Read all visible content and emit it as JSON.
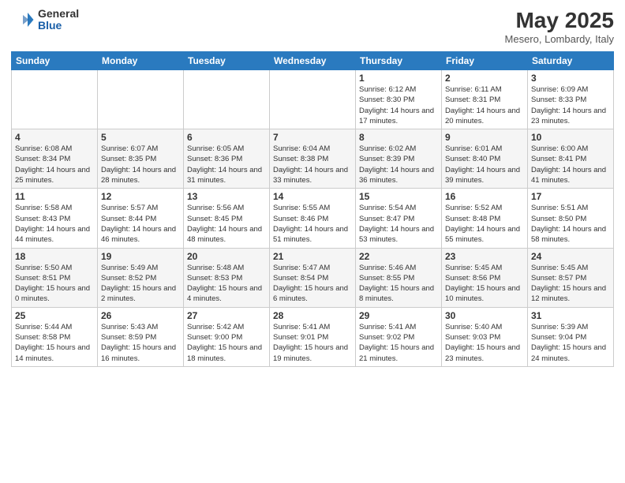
{
  "header": {
    "logo_general": "General",
    "logo_blue": "Blue",
    "title": "May 2025",
    "subtitle": "Mesero, Lombardy, Italy"
  },
  "days_of_week": [
    "Sunday",
    "Monday",
    "Tuesday",
    "Wednesday",
    "Thursday",
    "Friday",
    "Saturday"
  ],
  "weeks": [
    [
      {
        "day": "",
        "info": ""
      },
      {
        "day": "",
        "info": ""
      },
      {
        "day": "",
        "info": ""
      },
      {
        "day": "",
        "info": ""
      },
      {
        "day": "1",
        "info": "Sunrise: 6:12 AM\nSunset: 8:30 PM\nDaylight: 14 hours\nand 17 minutes."
      },
      {
        "day": "2",
        "info": "Sunrise: 6:11 AM\nSunset: 8:31 PM\nDaylight: 14 hours\nand 20 minutes."
      },
      {
        "day": "3",
        "info": "Sunrise: 6:09 AM\nSunset: 8:33 PM\nDaylight: 14 hours\nand 23 minutes."
      }
    ],
    [
      {
        "day": "4",
        "info": "Sunrise: 6:08 AM\nSunset: 8:34 PM\nDaylight: 14 hours\nand 25 minutes."
      },
      {
        "day": "5",
        "info": "Sunrise: 6:07 AM\nSunset: 8:35 PM\nDaylight: 14 hours\nand 28 minutes."
      },
      {
        "day": "6",
        "info": "Sunrise: 6:05 AM\nSunset: 8:36 PM\nDaylight: 14 hours\nand 31 minutes."
      },
      {
        "day": "7",
        "info": "Sunrise: 6:04 AM\nSunset: 8:38 PM\nDaylight: 14 hours\nand 33 minutes."
      },
      {
        "day": "8",
        "info": "Sunrise: 6:02 AM\nSunset: 8:39 PM\nDaylight: 14 hours\nand 36 minutes."
      },
      {
        "day": "9",
        "info": "Sunrise: 6:01 AM\nSunset: 8:40 PM\nDaylight: 14 hours\nand 39 minutes."
      },
      {
        "day": "10",
        "info": "Sunrise: 6:00 AM\nSunset: 8:41 PM\nDaylight: 14 hours\nand 41 minutes."
      }
    ],
    [
      {
        "day": "11",
        "info": "Sunrise: 5:58 AM\nSunset: 8:43 PM\nDaylight: 14 hours\nand 44 minutes."
      },
      {
        "day": "12",
        "info": "Sunrise: 5:57 AM\nSunset: 8:44 PM\nDaylight: 14 hours\nand 46 minutes."
      },
      {
        "day": "13",
        "info": "Sunrise: 5:56 AM\nSunset: 8:45 PM\nDaylight: 14 hours\nand 48 minutes."
      },
      {
        "day": "14",
        "info": "Sunrise: 5:55 AM\nSunset: 8:46 PM\nDaylight: 14 hours\nand 51 minutes."
      },
      {
        "day": "15",
        "info": "Sunrise: 5:54 AM\nSunset: 8:47 PM\nDaylight: 14 hours\nand 53 minutes."
      },
      {
        "day": "16",
        "info": "Sunrise: 5:52 AM\nSunset: 8:48 PM\nDaylight: 14 hours\nand 55 minutes."
      },
      {
        "day": "17",
        "info": "Sunrise: 5:51 AM\nSunset: 8:50 PM\nDaylight: 14 hours\nand 58 minutes."
      }
    ],
    [
      {
        "day": "18",
        "info": "Sunrise: 5:50 AM\nSunset: 8:51 PM\nDaylight: 15 hours\nand 0 minutes."
      },
      {
        "day": "19",
        "info": "Sunrise: 5:49 AM\nSunset: 8:52 PM\nDaylight: 15 hours\nand 2 minutes."
      },
      {
        "day": "20",
        "info": "Sunrise: 5:48 AM\nSunset: 8:53 PM\nDaylight: 15 hours\nand 4 minutes."
      },
      {
        "day": "21",
        "info": "Sunrise: 5:47 AM\nSunset: 8:54 PM\nDaylight: 15 hours\nand 6 minutes."
      },
      {
        "day": "22",
        "info": "Sunrise: 5:46 AM\nSunset: 8:55 PM\nDaylight: 15 hours\nand 8 minutes."
      },
      {
        "day": "23",
        "info": "Sunrise: 5:45 AM\nSunset: 8:56 PM\nDaylight: 15 hours\nand 10 minutes."
      },
      {
        "day": "24",
        "info": "Sunrise: 5:45 AM\nSunset: 8:57 PM\nDaylight: 15 hours\nand 12 minutes."
      }
    ],
    [
      {
        "day": "25",
        "info": "Sunrise: 5:44 AM\nSunset: 8:58 PM\nDaylight: 15 hours\nand 14 minutes."
      },
      {
        "day": "26",
        "info": "Sunrise: 5:43 AM\nSunset: 8:59 PM\nDaylight: 15 hours\nand 16 minutes."
      },
      {
        "day": "27",
        "info": "Sunrise: 5:42 AM\nSunset: 9:00 PM\nDaylight: 15 hours\nand 18 minutes."
      },
      {
        "day": "28",
        "info": "Sunrise: 5:41 AM\nSunset: 9:01 PM\nDaylight: 15 hours\nand 19 minutes."
      },
      {
        "day": "29",
        "info": "Sunrise: 5:41 AM\nSunset: 9:02 PM\nDaylight: 15 hours\nand 21 minutes."
      },
      {
        "day": "30",
        "info": "Sunrise: 5:40 AM\nSunset: 9:03 PM\nDaylight: 15 hours\nand 23 minutes."
      },
      {
        "day": "31",
        "info": "Sunrise: 5:39 AM\nSunset: 9:04 PM\nDaylight: 15 hours\nand 24 minutes."
      }
    ]
  ]
}
